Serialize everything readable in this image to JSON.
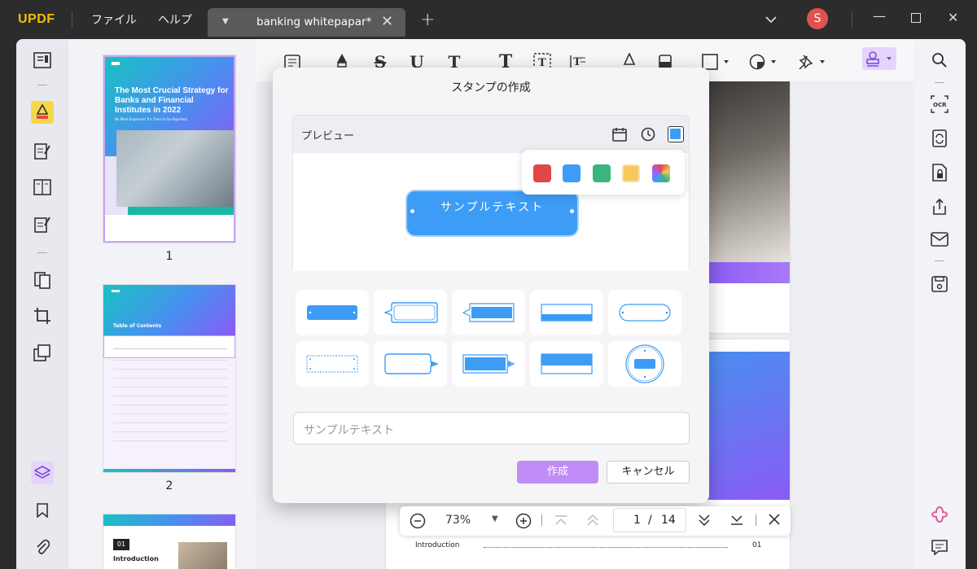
{
  "titlebar": {
    "logo": "UPDF",
    "menu_file": "ファイル",
    "menu_help": "ヘルプ",
    "tab_title": "banking whitepapar*",
    "avatar_initial": "S"
  },
  "thumbnails": {
    "page1_number": "1",
    "page2_number": "2",
    "page1_title": "The Most Crucial Strategy for Banks and Financial Institutes in 2022",
    "page1_subtitle": "No More Expenses! It's Time to Go Paperless",
    "page2_heading": "Table of Contents",
    "page3_chapter": "01",
    "page3_heading": "Introduction",
    "brand_small": "UPDF"
  },
  "dialog": {
    "title": "スタンプの作成",
    "preview_label": "プレビュー",
    "stamp_text": "サンプルテキスト",
    "input_placeholder": "サンプルテキスト",
    "create_label": "作成",
    "cancel_label": "キャンセル",
    "colors": [
      "#e04848",
      "#3d9cf5",
      "#3bb57e",
      "#f7c95b",
      "gradient"
    ]
  },
  "zoombar": {
    "zoom": "73%",
    "current_page": "1",
    "separator": "/",
    "total_pages": "14"
  },
  "page_content": {
    "toc_entry": "Introduction",
    "toc_page": "01"
  },
  "colors": {
    "accent_purple": "#c08cf5",
    "stamp_blue": "#3d9cf5"
  }
}
